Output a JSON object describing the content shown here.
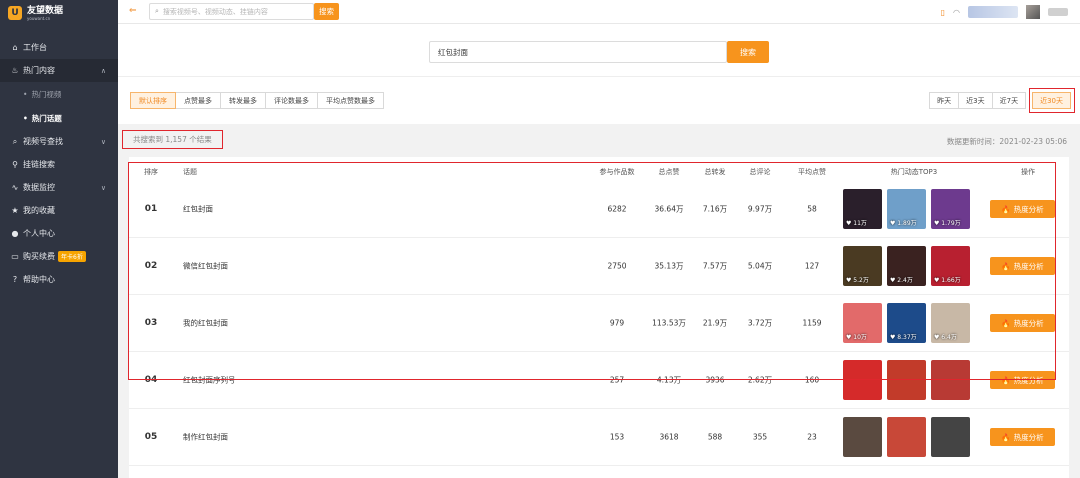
{
  "brand": {
    "name": "友望数据",
    "sub": "youwant.cn",
    "mark": "U"
  },
  "sidebar": {
    "items": [
      {
        "icon": "home-icon",
        "glyph": "⌂",
        "label": "工作台"
      },
      {
        "icon": "fire-icon",
        "glyph": "♨",
        "label": "热门内容",
        "caret": "∧"
      },
      {
        "sub": true,
        "label": "热门视频"
      },
      {
        "sub": true,
        "label": "热门话题",
        "active": true
      },
      {
        "icon": "search-icon",
        "glyph": "⌕",
        "label": "视频号查找",
        "caret": "∨"
      },
      {
        "icon": "link-icon",
        "glyph": "⚲",
        "label": "挂链搜索"
      },
      {
        "icon": "pulse-icon",
        "glyph": "∿",
        "label": "数据监控",
        "caret": "∨"
      },
      {
        "icon": "star-icon",
        "glyph": "★",
        "label": "我的收藏"
      },
      {
        "icon": "user-icon",
        "glyph": "●",
        "label": "个人中心"
      },
      {
        "icon": "card-icon",
        "glyph": "▭",
        "label": "购买续费",
        "badge": "年卡6折"
      },
      {
        "icon": "help-icon",
        "glyph": "?",
        "label": "帮助中心"
      }
    ]
  },
  "topbar": {
    "placeholder": "搜索视频号、视频动态、挂链内容",
    "search_label": "搜索"
  },
  "search": {
    "value": "红包封面",
    "button": "搜索"
  },
  "sort_tabs": [
    "默认排序",
    "点赞最多",
    "转发最多",
    "评论数最多",
    "平均点赞数最多"
  ],
  "range_tabs": [
    "昨天",
    "近3天",
    "近7天",
    "近30天"
  ],
  "result": {
    "count_text": "共搜索到 1,157 个结果",
    "update_label": "数据更新时间：2021-02-23 05:06"
  },
  "columns": {
    "rank": "排序",
    "topic": "话题",
    "works": "参与作品数",
    "likes": "总点赞",
    "shares": "总转发",
    "comments": "总评论",
    "avg": "平均点赞",
    "top3": "热门动态TOP3",
    "action": "操作"
  },
  "rows": [
    {
      "rank": "01",
      "topic": "红包封面",
      "works": "6282",
      "likes": "36.64万",
      "shares": "7.16万",
      "comments": "9.97万",
      "avg": "58",
      "thumbs": [
        {
          "likes": "♥ 11万",
          "color": "#2a1f2b"
        },
        {
          "likes": "♥ 1.89万",
          "color": "#6f9fc9"
        },
        {
          "likes": "♥ 1.79万",
          "color": "#6d3a8e"
        }
      ]
    },
    {
      "rank": "02",
      "topic": "微信红包封面",
      "works": "2750",
      "likes": "35.13万",
      "shares": "7.57万",
      "comments": "5.04万",
      "avg": "127",
      "thumbs": [
        {
          "likes": "♥ 5.2万",
          "color": "#4a3a22"
        },
        {
          "likes": "♥ 2.4万",
          "color": "#3a2220"
        },
        {
          "likes": "♥ 1.66万",
          "color": "#b82030"
        }
      ]
    },
    {
      "rank": "03",
      "topic": "我的红包封面",
      "works": "979",
      "likes": "113.53万",
      "shares": "21.9万",
      "comments": "3.72万",
      "avg": "1159",
      "thumbs": [
        {
          "likes": "♥ 10万",
          "color": "#e26a6a"
        },
        {
          "likes": "♥ 8.37万",
          "color": "#1d4b8a"
        },
        {
          "likes": "♥ 6.4万",
          "color": "#c8b8a6"
        }
      ]
    },
    {
      "rank": "04",
      "topic": "红包封面序列号",
      "works": "257",
      "likes": "4.13万",
      "shares": "3936",
      "comments": "2.62万",
      "avg": "160",
      "thumbs": [
        {
          "likes": "",
          "color": "#d52a2a"
        },
        {
          "likes": "",
          "color": "#c23b2a"
        },
        {
          "likes": "",
          "color": "#b83a34"
        }
      ]
    },
    {
      "rank": "05",
      "topic": "制作红包封面",
      "works": "153",
      "likes": "3618",
      "shares": "588",
      "comments": "355",
      "avg": "23",
      "thumbs": [
        {
          "likes": "",
          "color": "#5a4a40"
        },
        {
          "likes": "",
          "color": "#c84838"
        },
        {
          "likes": "",
          "color": "#444"
        }
      ]
    }
  ],
  "action_label": "热度分析"
}
